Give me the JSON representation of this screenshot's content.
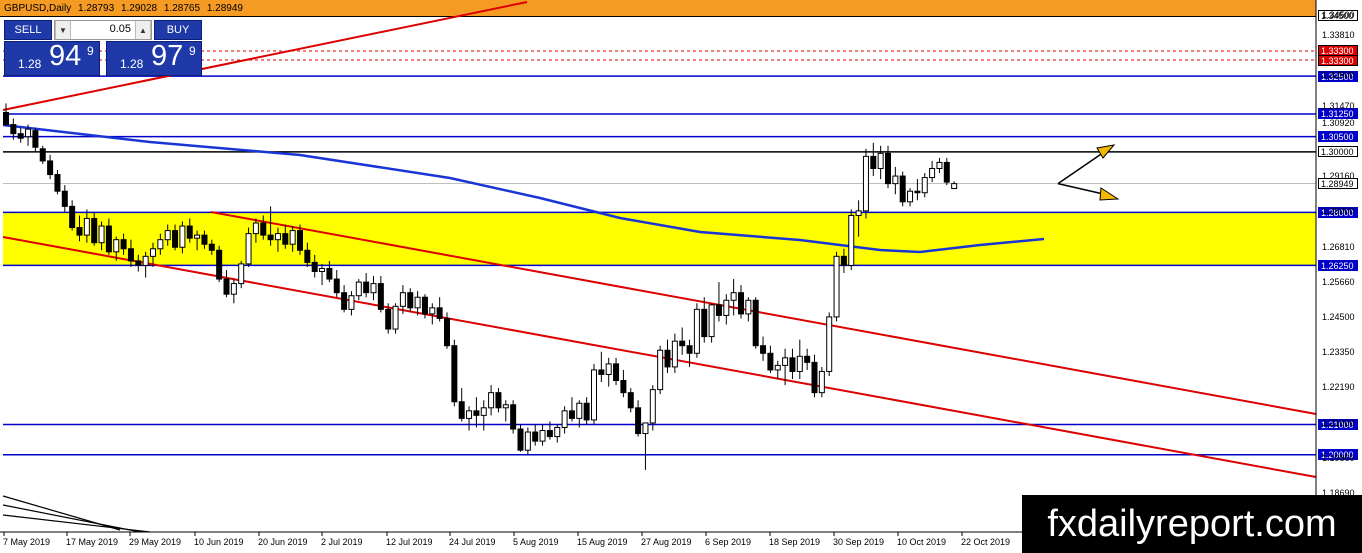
{
  "header": {
    "symbol": "GBPUSD,Daily",
    "open": "1.28793",
    "high": "1.29028",
    "low": "1.28765",
    "close": "1.28949"
  },
  "trade_panel": {
    "sell_label": "SELL",
    "buy_label": "BUY",
    "lot": "0.05",
    "sell_price_prefix": "1.28",
    "sell_price_big": "94",
    "sell_price_sup": "9",
    "buy_price_prefix": "1.28",
    "buy_price_big": "97",
    "buy_price_sup": "9"
  },
  "watermark": "fxdailyreport.com",
  "colors": {
    "zone_fill": "#ffff00",
    "support_resistance": "#0000c8",
    "channel": "#dd0000",
    "moving_average": "#1a35d6",
    "orange_top": "#f59a23"
  },
  "chart_data": {
    "type": "candlestick",
    "symbol": "GBPUSD",
    "timeframe": "Daily",
    "x_tick_labels": [
      "7 May 2019",
      "17 May 2019",
      "29 May 2019",
      "10 Jun 2019",
      "20 Jun 2019",
      "2 Jul 2019",
      "12 Jul 2019",
      "24 Jul 2019",
      "5 Aug 2019",
      "15 Aug 2019",
      "27 Aug 2019",
      "6 Sep 2019",
      "18 Sep 2019",
      "30 Sep 2019",
      "10 Oct 2019",
      "22 Oct 2019"
    ],
    "y_tick_labels": [
      "1.34500",
      "1.33810",
      "1.32500",
      "1.31470",
      "1.30920",
      "1.29160",
      "1.28000",
      "1.26810",
      "1.25660",
      "1.24500",
      "1.23350",
      "1.22190",
      "1.21000",
      "1.19860",
      "1.18690"
    ],
    "ylim": [
      1.1745,
      1.3455
    ],
    "horizontal_levels": [
      {
        "value": 1.345,
        "label": "1.34500",
        "style": "orange"
      },
      {
        "value": 1.3333,
        "label": "1.33300",
        "style": "red-dashed"
      },
      {
        "value": 1.3303,
        "label": "1.33300",
        "style": "red-dashed"
      },
      {
        "value": 1.325,
        "label": "1.32500",
        "style": "blue"
      },
      {
        "value": 1.3125,
        "label": "1.31250",
        "style": "blue"
      },
      {
        "value": 1.305,
        "label": "1.30500",
        "style": "blue"
      },
      {
        "value": 1.3,
        "label": "1.30000",
        "style": "black"
      },
      {
        "value": 1.28949,
        "label": "1.28949",
        "style": "current"
      },
      {
        "value": 1.28,
        "label": "1.28000",
        "style": "blue"
      },
      {
        "value": 1.2625,
        "label": "1.26250",
        "style": "blue"
      },
      {
        "value": 1.21,
        "label": "1.21000",
        "style": "blue"
      },
      {
        "value": 1.2,
        "label": "1.20000",
        "style": "blue"
      }
    ],
    "zone": [
      1.2625,
      1.28
    ],
    "candles": [
      [
        1.313,
        1.316,
        1.3085,
        1.309
      ],
      [
        1.309,
        1.311,
        1.304,
        1.306
      ],
      [
        1.306,
        1.308,
        1.303,
        1.3045
      ],
      [
        1.305,
        1.309,
        1.302,
        1.3075
      ],
      [
        1.307,
        1.308,
        1.3,
        1.3015
      ],
      [
        1.301,
        1.302,
        1.296,
        1.297
      ],
      [
        1.297,
        1.299,
        1.291,
        1.2925
      ],
      [
        1.2925,
        1.294,
        1.286,
        1.287
      ],
      [
        1.287,
        1.289,
        1.28,
        1.282
      ],
      [
        1.282,
        1.284,
        1.274,
        1.275
      ],
      [
        1.275,
        1.279,
        1.2705,
        1.2725
      ],
      [
        1.2725,
        1.281,
        1.27,
        1.278
      ],
      [
        1.278,
        1.28,
        1.269,
        1.27
      ],
      [
        1.27,
        1.277,
        1.2675,
        1.2755
      ],
      [
        1.2755,
        1.278,
        1.266,
        1.267
      ],
      [
        1.267,
        1.272,
        1.264,
        1.271
      ],
      [
        1.271,
        1.273,
        1.266,
        1.268
      ],
      [
        1.268,
        1.271,
        1.262,
        1.264
      ],
      [
        1.264,
        1.266,
        1.2605,
        1.2625
      ],
      [
        1.2625,
        1.267,
        1.2585,
        1.2655
      ],
      [
        1.2655,
        1.27,
        1.262,
        1.268
      ],
      [
        1.268,
        1.273,
        1.266,
        1.271
      ],
      [
        1.271,
        1.276,
        1.269,
        1.274
      ],
      [
        1.274,
        1.276,
        1.2675,
        1.2685
      ],
      [
        1.2685,
        1.277,
        1.2665,
        1.2755
      ],
      [
        1.2755,
        1.278,
        1.27,
        1.2715
      ],
      [
        1.2715,
        1.274,
        1.2675,
        1.2725
      ],
      [
        1.2725,
        1.274,
        1.268,
        1.2695
      ],
      [
        1.2695,
        1.271,
        1.266,
        1.2675
      ],
      [
        1.2675,
        1.269,
        1.257,
        1.258
      ],
      [
        1.258,
        1.261,
        1.252,
        1.253
      ],
      [
        1.253,
        1.258,
        1.25,
        1.2565
      ],
      [
        1.2565,
        1.264,
        1.255,
        1.263
      ],
      [
        1.263,
        1.275,
        1.262,
        1.273
      ],
      [
        1.273,
        1.278,
        1.27,
        1.2765
      ],
      [
        1.2765,
        1.279,
        1.271,
        1.2725
      ],
      [
        1.2725,
        1.282,
        1.269,
        1.271
      ],
      [
        1.271,
        1.275,
        1.267,
        1.273
      ],
      [
        1.273,
        1.276,
        1.268,
        1.2695
      ],
      [
        1.2695,
        1.2755,
        1.267,
        1.274
      ],
      [
        1.274,
        1.276,
        1.266,
        1.2675
      ],
      [
        1.2675,
        1.27,
        1.262,
        1.2635
      ],
      [
        1.2635,
        1.266,
        1.2585,
        1.2605
      ],
      [
        1.2605,
        1.263,
        1.256,
        1.2615
      ],
      [
        1.2615,
        1.264,
        1.257,
        1.258
      ],
      [
        1.258,
        1.261,
        1.252,
        1.2535
      ],
      [
        1.2535,
        1.256,
        1.247,
        1.248
      ],
      [
        1.248,
        1.254,
        1.246,
        1.2525
      ],
      [
        1.2525,
        1.258,
        1.251,
        1.257
      ],
      [
        1.257,
        1.26,
        1.252,
        1.2535
      ],
      [
        1.2535,
        1.259,
        1.251,
        1.2565
      ],
      [
        1.2565,
        1.259,
        1.247,
        1.248
      ],
      [
        1.248,
        1.25,
        1.24,
        1.2415
      ],
      [
        1.2415,
        1.25,
        1.24,
        1.249
      ],
      [
        1.249,
        1.256,
        1.2465,
        1.2535
      ],
      [
        1.2535,
        1.255,
        1.247,
        1.2485
      ],
      [
        1.2485,
        1.254,
        1.246,
        1.252
      ],
      [
        1.252,
        1.253,
        1.245,
        1.2465
      ],
      [
        1.2465,
        1.25,
        1.243,
        1.2485
      ],
      [
        1.2485,
        1.252,
        1.244,
        1.245
      ],
      [
        1.245,
        1.247,
        1.235,
        1.236
      ],
      [
        1.236,
        1.238,
        1.216,
        1.2175
      ],
      [
        1.2175,
        1.222,
        1.211,
        1.212
      ],
      [
        1.212,
        1.216,
        1.208,
        1.2145
      ],
      [
        1.2145,
        1.219,
        1.209,
        1.213
      ],
      [
        1.213,
        1.218,
        1.208,
        1.2155
      ],
      [
        1.2155,
        1.223,
        1.213,
        1.2205
      ],
      [
        1.2205,
        1.222,
        1.214,
        1.2155
      ],
      [
        1.2155,
        1.218,
        1.211,
        1.2165
      ],
      [
        1.2165,
        1.218,
        1.207,
        1.2085
      ],
      [
        1.2085,
        1.21,
        1.201,
        1.2015
      ],
      [
        1.2015,
        1.209,
        1.2,
        1.2075
      ],
      [
        1.2075,
        1.21,
        1.203,
        1.2045
      ],
      [
        1.2045,
        1.21,
        1.203,
        1.208
      ],
      [
        1.208,
        1.211,
        1.205,
        1.206
      ],
      [
        1.206,
        1.21,
        1.204,
        1.209
      ],
      [
        1.209,
        1.216,
        1.207,
        1.2145
      ],
      [
        1.2145,
        1.219,
        1.211,
        1.212
      ],
      [
        1.212,
        1.218,
        1.209,
        1.217
      ],
      [
        1.217,
        1.219,
        1.21,
        1.2115
      ],
      [
        1.2115,
        1.23,
        1.21,
        1.228
      ],
      [
        1.228,
        1.234,
        1.224,
        1.2265
      ],
      [
        1.2265,
        1.232,
        1.2225,
        1.23
      ],
      [
        1.23,
        1.232,
        1.223,
        1.2245
      ],
      [
        1.2245,
        1.228,
        1.219,
        1.2205
      ],
      [
        1.2205,
        1.222,
        1.214,
        1.2155
      ],
      [
        1.2155,
        1.218,
        1.206,
        1.207
      ],
      [
        1.207,
        1.21,
        1.195,
        1.2105
      ],
      [
        1.2105,
        1.223,
        1.208,
        1.2215
      ],
      [
        1.2215,
        1.236,
        1.22,
        1.2345
      ],
      [
        1.2345,
        1.238,
        1.227,
        1.229
      ],
      [
        1.229,
        1.24,
        1.227,
        1.2375
      ],
      [
        1.2375,
        1.242,
        1.233,
        1.236
      ],
      [
        1.236,
        1.238,
        1.229,
        1.2335
      ],
      [
        1.2335,
        1.25,
        1.232,
        1.248
      ],
      [
        1.248,
        1.252,
        1.237,
        1.239
      ],
      [
        1.239,
        1.25,
        1.237,
        1.2495
      ],
      [
        1.2495,
        1.257,
        1.244,
        1.246
      ],
      [
        1.246,
        1.253,
        1.243,
        1.251
      ],
      [
        1.251,
        1.258,
        1.246,
        1.2535
      ],
      [
        1.2535,
        1.256,
        1.245,
        1.2465
      ],
      [
        1.2465,
        1.252,
        1.244,
        1.251
      ],
      [
        1.251,
        1.252,
        1.235,
        1.236
      ],
      [
        1.236,
        1.239,
        1.231,
        1.2335
      ],
      [
        1.2335,
        1.236,
        1.227,
        1.228
      ],
      [
        1.228,
        1.231,
        1.225,
        1.2295
      ],
      [
        1.2295,
        1.235,
        1.223,
        1.232
      ],
      [
        1.232,
        1.235,
        1.225,
        1.2275
      ],
      [
        1.2275,
        1.238,
        1.225,
        1.2325
      ],
      [
        1.2325,
        1.235,
        1.228,
        1.2305
      ],
      [
        1.2305,
        1.233,
        1.219,
        1.2205
      ],
      [
        1.2205,
        1.229,
        1.219,
        1.2275
      ],
      [
        1.2275,
        1.247,
        1.226,
        1.2455
      ],
      [
        1.2455,
        1.267,
        1.244,
        1.2655
      ],
      [
        1.2655,
        1.268,
        1.26,
        1.2625
      ],
      [
        1.2625,
        1.281,
        1.261,
        1.279
      ],
      [
        1.279,
        1.284,
        1.272,
        1.2805
      ],
      [
        1.2805,
        1.301,
        1.278,
        1.2985
      ],
      [
        1.2985,
        1.303,
        1.292,
        1.2945
      ],
      [
        1.2945,
        1.302,
        1.291,
        1.2995
      ],
      [
        1.2995,
        1.302,
        1.288,
        1.2895
      ],
      [
        1.2895,
        1.295,
        1.286,
        1.292
      ],
      [
        1.292,
        1.2935,
        1.282,
        1.2835
      ],
      [
        1.2835,
        1.288,
        1.282,
        1.287
      ],
      [
        1.287,
        1.291,
        1.284,
        1.2865
      ],
      [
        1.2865,
        1.293,
        1.285,
        1.2915
      ],
      [
        1.2915,
        1.297,
        1.29,
        1.2945
      ],
      [
        1.2945,
        1.298,
        1.293,
        1.2965
      ],
      [
        1.2965,
        1.298,
        1.289,
        1.29
      ],
      [
        1.2879,
        1.2903,
        1.2877,
        1.2895
      ]
    ]
  }
}
